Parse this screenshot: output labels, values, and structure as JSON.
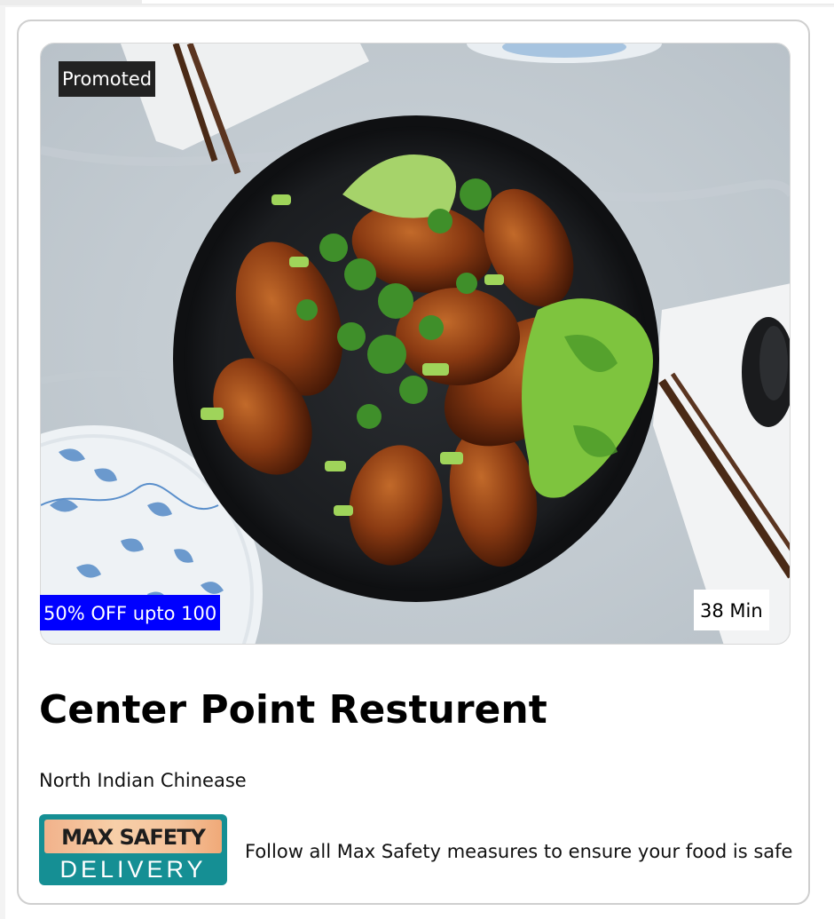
{
  "card": {
    "promoted_label": "Promoted",
    "offer_label": "50% OFF upto 100",
    "delivery_time": "38 Min",
    "restaurant_name": "Center Point Resturent",
    "cuisine": "North Indian Chinease",
    "safety_logo_top": "MAX SAFETY",
    "safety_logo_bottom": "DELIVERY",
    "safety_message": "Follow all Max Safety measures to ensure your food is safe"
  },
  "colors": {
    "offer_badge_bg": "#0000ff",
    "promoted_badge_bg": "#222222",
    "safety_logo_teal": "#158f94"
  },
  "icons": {
    "food_image": "chicken-wings-bowl-photo",
    "safety_logo": "max-safety-delivery-logo"
  }
}
